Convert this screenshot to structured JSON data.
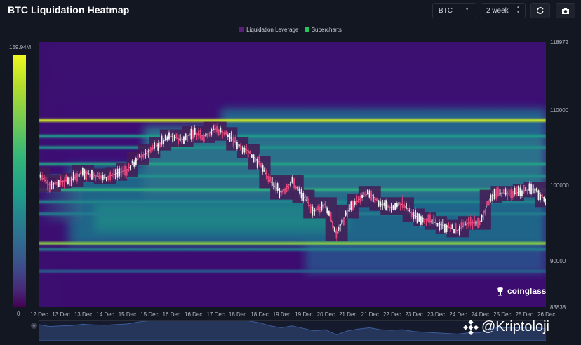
{
  "header": {
    "title": "BTC Liquidation Heatmap",
    "coin_select": {
      "value": "BTC"
    },
    "range_select": {
      "value": "2 week"
    },
    "refresh_icon": "refresh-icon",
    "camera_icon": "camera-icon"
  },
  "legend": [
    {
      "label": "Liquidation Leverage",
      "color": "#5b1f7a"
    },
    {
      "label": "Supercharts",
      "color": "#22c55e"
    }
  ],
  "colorbar": {
    "max_label": "159.94M",
    "min_label": "0"
  },
  "branding": {
    "logo_text": "coinglass",
    "watermark": "@Kriptoloji"
  },
  "chart_data": {
    "type": "heatmap",
    "title": "",
    "ylim": [
      83838,
      118972
    ],
    "yticks": [
      "118972",
      "110000",
      "100000",
      "90000",
      "83838"
    ],
    "xticks": [
      "12 Dec",
      "13 Dec",
      "13 Dec",
      "14 Dec",
      "15 Dec",
      "15 Dec",
      "16 Dec",
      "16 Dec",
      "17 Dec",
      "18 Dec",
      "18 Dec",
      "19 Dec",
      "19 Dec",
      "20 Dec",
      "21 Dec",
      "21 Dec",
      "22 Dec",
      "23 Dec",
      "23 Dec",
      "24 Dec",
      "24 Dec",
      "25 Dec",
      "25 Dec",
      "26 Dec"
    ],
    "colorscale": {
      "min": 0,
      "max": "159.94M"
    },
    "liquidation_bands": [
      {
        "price": 108600,
        "intensity": 0.95
      },
      {
        "price": 106500,
        "intensity": 0.55
      },
      {
        "price": 105000,
        "intensity": 0.5
      },
      {
        "price": 102800,
        "intensity": 0.6
      },
      {
        "price": 101200,
        "intensity": 0.5
      },
      {
        "price": 99400,
        "intensity": 0.7
      },
      {
        "price": 97800,
        "intensity": 0.45
      },
      {
        "price": 96200,
        "intensity": 0.4
      },
      {
        "price": 92300,
        "intensity": 0.85
      },
      {
        "price": 91500,
        "intensity": 0.4
      },
      {
        "price": 88600,
        "intensity": 0.3
      }
    ],
    "price_series": [
      {
        "x": 0.0,
        "y": 101500
      },
      {
        "x": 0.5,
        "y": 100000
      },
      {
        "x": 1.0,
        "y": 100500
      },
      {
        "x": 1.5,
        "y": 100700
      },
      {
        "x": 2.0,
        "y": 101800
      },
      {
        "x": 2.5,
        "y": 101300
      },
      {
        "x": 3.0,
        "y": 101000
      },
      {
        "x": 3.5,
        "y": 101500
      },
      {
        "x": 4.0,
        "y": 102000
      },
      {
        "x": 4.5,
        "y": 103500
      },
      {
        "x": 5.0,
        "y": 104500
      },
      {
        "x": 5.5,
        "y": 105500
      },
      {
        "x": 6.0,
        "y": 106500
      },
      {
        "x": 6.5,
        "y": 106000
      },
      {
        "x": 7.0,
        "y": 107000
      },
      {
        "x": 7.5,
        "y": 106500
      },
      {
        "x": 8.0,
        "y": 107500
      },
      {
        "x": 8.5,
        "y": 106800
      },
      {
        "x": 9.0,
        "y": 105500
      },
      {
        "x": 9.5,
        "y": 104500
      },
      {
        "x": 10.0,
        "y": 103000
      },
      {
        "x": 10.5,
        "y": 100500
      },
      {
        "x": 11.0,
        "y": 99000
      },
      {
        "x": 11.5,
        "y": 100500
      },
      {
        "x": 12.0,
        "y": 98500
      },
      {
        "x": 12.5,
        "y": 96500
      },
      {
        "x": 13.0,
        "y": 97500
      },
      {
        "x": 13.5,
        "y": 93500
      },
      {
        "x": 14.0,
        "y": 96500
      },
      {
        "x": 14.5,
        "y": 98000
      },
      {
        "x": 15.0,
        "y": 99000
      },
      {
        "x": 15.5,
        "y": 97500
      },
      {
        "x": 16.0,
        "y": 97000
      },
      {
        "x": 16.5,
        "y": 97500
      },
      {
        "x": 17.0,
        "y": 96000
      },
      {
        "x": 17.5,
        "y": 95500
      },
      {
        "x": 18.0,
        "y": 95000
      },
      {
        "x": 18.5,
        "y": 94500
      },
      {
        "x": 19.0,
        "y": 94000
      },
      {
        "x": 19.5,
        "y": 95000
      },
      {
        "x": 20.0,
        "y": 95000
      },
      {
        "x": 20.5,
        "y": 98500
      },
      {
        "x": 21.0,
        "y": 99000
      },
      {
        "x": 21.5,
        "y": 98800
      },
      {
        "x": 22.0,
        "y": 99300
      },
      {
        "x": 22.5,
        "y": 99500
      },
      {
        "x": 23.0,
        "y": 98000
      },
      {
        "x": 23.4,
        "y": 96000
      }
    ]
  }
}
